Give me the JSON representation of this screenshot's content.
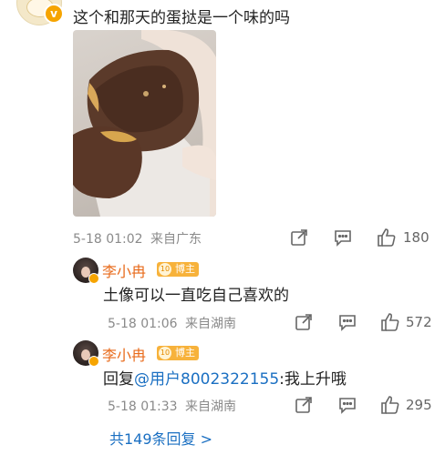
{
  "post": {
    "text": "这个和那天的蛋挞是一个味的吗",
    "time": "5-18 01:02",
    "location": "来自广东",
    "like_count": "180"
  },
  "replies": [
    {
      "username": "李小冉",
      "badge_level": "10",
      "badge_label": "博主",
      "text": "土像可以一直吃自己喜欢的",
      "time": "5-18 01:06",
      "location": "来自湖南",
      "like_count": "572"
    },
    {
      "username": "李小冉",
      "badge_level": "10",
      "badge_label": "博主",
      "reply_prefix": "回复",
      "mention": "@用户8002322155",
      "text": ":我上升哦",
      "time": "5-18 01:33",
      "location": "来自湖南",
      "like_count": "295"
    }
  ],
  "more_replies": "共149条回复 >",
  "colors": {
    "username": "#e86a1a",
    "link": "#1a6fc2",
    "badge": "#f7b23b",
    "meta": "#8a8a8a"
  },
  "icons": [
    "share-icon",
    "comment-icon",
    "like-icon",
    "verified-icon"
  ]
}
